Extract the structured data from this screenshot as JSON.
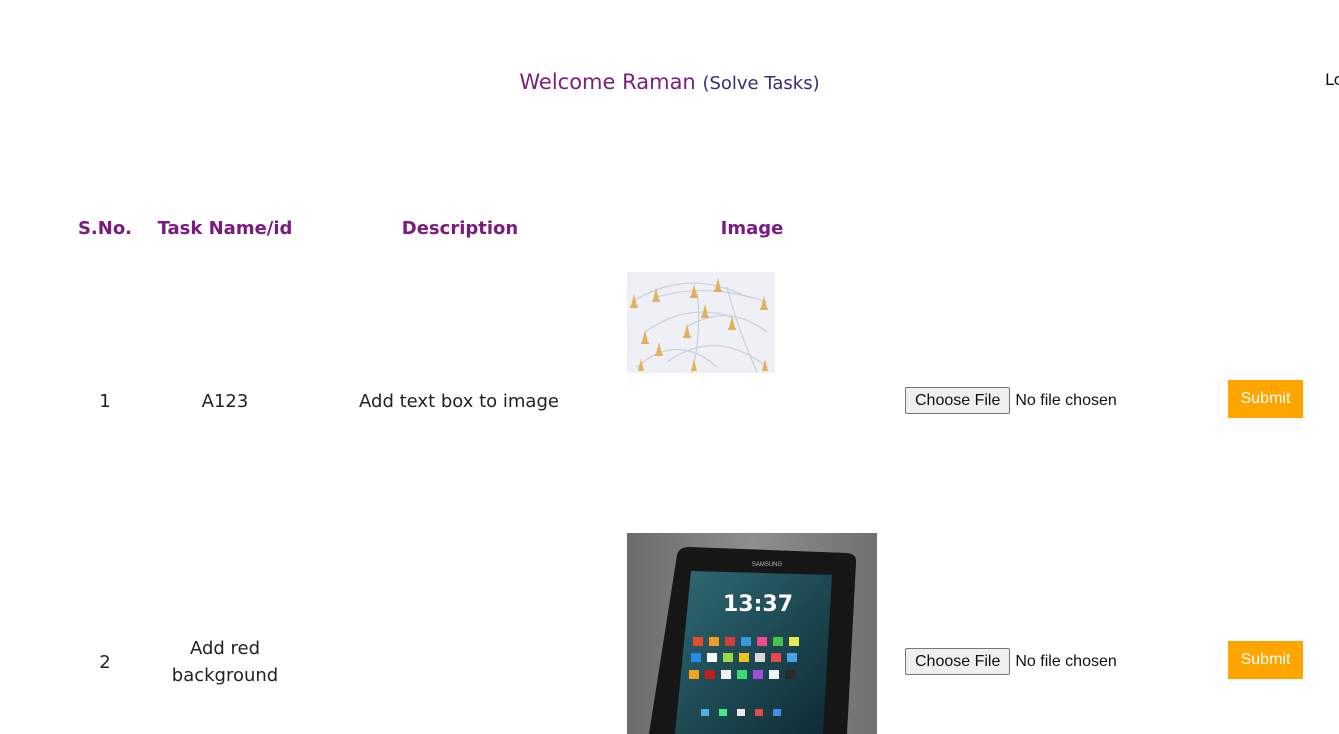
{
  "header": {
    "welcome": "Welcome Raman",
    "subtitle": "(Solve Tasks)",
    "logout": "Lo"
  },
  "table": {
    "columns": [
      "S.No.",
      "Task Name/id",
      "Description",
      "Image"
    ],
    "rows": [
      {
        "sno": "1",
        "task": "A123",
        "description": "Add text box to image",
        "image": "network-graph-image",
        "file_button": "Choose File",
        "file_status": "No file chosen",
        "submit": "Submit"
      },
      {
        "sno": "2",
        "task": "Add red background",
        "description": "",
        "image": "samsung-tablet-image",
        "file_button": "Choose File",
        "file_status": "No file chosen",
        "submit": "Submit"
      }
    ]
  },
  "tablet": {
    "brand": "SAMSUNG",
    "time": "13:37"
  },
  "colors": {
    "heading": "#7b1a80",
    "welcome": "#7b1f7b",
    "submit": "#ffa500"
  }
}
